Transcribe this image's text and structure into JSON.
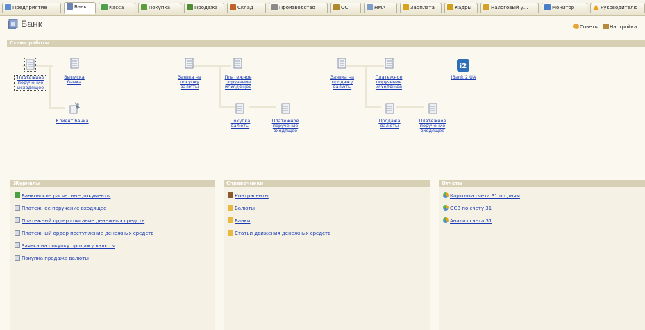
{
  "tabs": [
    {
      "label": "Предприятие",
      "active": false,
      "icon": "enterprise-icon",
      "color": "#5b8fd3"
    },
    {
      "label": "Банк",
      "active": true,
      "icon": "bank-icon",
      "color": "#6b84b5"
    },
    {
      "label": "Касса",
      "active": false,
      "icon": "cash-icon",
      "color": "#4fa04a"
    },
    {
      "label": "Покупка",
      "active": false,
      "icon": "purchase-icon",
      "color": "#5a9e3b"
    },
    {
      "label": "Продажа",
      "active": false,
      "icon": "sale-icon",
      "color": "#4d8f32"
    },
    {
      "label": "Склад",
      "active": false,
      "icon": "warehouse-icon",
      "color": "#c45f2a"
    },
    {
      "label": "Производство",
      "active": false,
      "icon": "production-icon",
      "color": "#8a8a8a"
    },
    {
      "label": "ОС",
      "active": false,
      "icon": "fixed-assets-icon",
      "color": "#b0882c"
    },
    {
      "label": "НМА",
      "active": false,
      "icon": "intangible-icon",
      "color": "#7b9dc7"
    },
    {
      "label": "Зарплата",
      "active": false,
      "icon": "salary-icon",
      "color": "#d9a21c"
    },
    {
      "label": "Кадры",
      "active": false,
      "icon": "personnel-icon",
      "color": "#d2a017"
    },
    {
      "label": "Налоговый у...",
      "active": false,
      "icon": "tax-icon",
      "color": "#d4a125"
    },
    {
      "label": "Монитор",
      "active": false,
      "icon": "monitor-icon",
      "color": "#4b7ec8"
    },
    {
      "label": "Руководителю",
      "active": false,
      "icon": "warning-icon",
      "color": "#e8a118"
    }
  ],
  "page": {
    "title": "Банк",
    "tips": "Советы",
    "separator": "|",
    "settings": "Настройка..."
  },
  "scheme": {
    "header": "Схема работы",
    "nodes": {
      "payment_out_1": "Платежное поручение исходящее",
      "bank_statement": "Выписка банка",
      "bank_client": "Клиент банка",
      "request_buy_currency": "Заявка на покупку валюты",
      "payment_out_2": "Платежное поручение исходящее",
      "buy_currency": "Покупка валюты",
      "payment_in_1": "Платежное поручение входящее",
      "request_sell_currency": "Заявка на продажу валюты",
      "payment_out_3": "Платежное поручение исходящее",
      "sell_currency": "Продажа валюты",
      "payment_in_2": "Платежное поручение входящее",
      "ibank": "iBank 2 UA"
    }
  },
  "journals": {
    "header": "Журналы",
    "items": [
      "Банковские расчетные документы",
      "Платежное поручение входящее",
      "Платежный ордер списание денежных средств",
      "Платежный ордер поступление денежных средств",
      "Заявка на покупку продажу валюты",
      "Покупка продажа валюты"
    ]
  },
  "catalogs": {
    "header": "Справочники",
    "items": [
      "Контрагенты",
      "Валюты",
      "Банки",
      "Статьи движения денежных средств"
    ]
  },
  "reports": {
    "header": "Отчеты",
    "items": [
      "Карточка счета 31 по дням",
      "ОСВ по счету 31",
      "Анализ счета 31"
    ]
  }
}
